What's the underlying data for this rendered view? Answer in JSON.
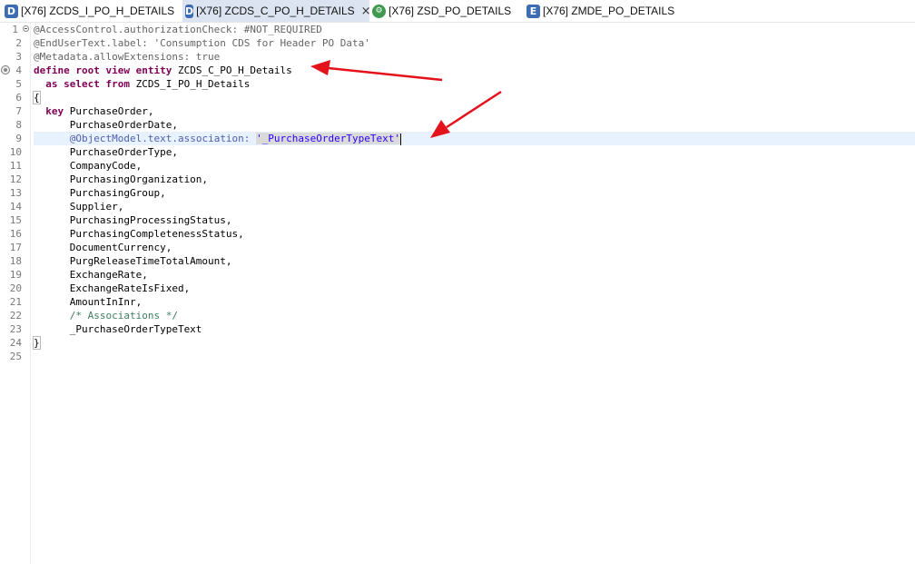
{
  "tabs": [
    {
      "icon": "D",
      "label": "[X76] ZCDS_I_PO_H_DETAILS",
      "active": false
    },
    {
      "icon": "D",
      "label": "[X76] ZCDS_C_PO_H_DETAILS",
      "active": true,
      "close": "×"
    },
    {
      "icon": "⚙",
      "label": "[X76] ZSD_PO_DETAILS",
      "active": false
    },
    {
      "icon": "E",
      "label": "[X76] ZMDE_PO_DETAILS",
      "active": false
    }
  ],
  "line_numbers": [
    "1",
    "2",
    "3",
    "4",
    "5",
    "6",
    "7",
    "8",
    "9",
    "10",
    "11",
    "12",
    "13",
    "14",
    "15",
    "16",
    "17",
    "18",
    "19",
    "20",
    "21",
    "22",
    "23",
    "24",
    "25"
  ],
  "code": {
    "l1": "@AccessControl.authorizationCheck: #NOT_REQUIRED",
    "l2": "@EndUserText.label: 'Consumption CDS for Header PO Data'",
    "l3": "@Metadata.allowExtensions: true",
    "l4_kw": "define root view entity",
    "l4_name": " ZCDS_C_PO_H_Details",
    "l5_kw": "  as select from",
    "l5_name": " ZCDS_I_PO_H_Details",
    "l6": "{",
    "l7_kw": "  key",
    "l7_name": " PurchaseOrder,",
    "l8": "      PurchaseOrderDate,",
    "l9_indent": "      ",
    "l9_ann": "@ObjectModel.text.association:",
    "l9_sp": " ",
    "l9_str": "'_PurchaseOrderTypeText'",
    "l10": "      PurchaseOrderType,",
    "l11": "      CompanyCode,",
    "l12": "      PurchasingOrganization,",
    "l13": "      PurchasingGroup,",
    "l14": "      Supplier,",
    "l15": "      PurchasingProcessingStatus,",
    "l16": "      PurchasingCompletenessStatus,",
    "l17": "      DocumentCurrency,",
    "l18": "      PurgReleaseTimeTotalAmount,",
    "l19": "      ExchangeRate,",
    "l20": "      ExchangeRateIsFixed,",
    "l21": "      AmountInInr,",
    "l22_indent": "      ",
    "l22_cmt": "/* Associations */",
    "l23": "      _PurchaseOrderTypeText",
    "l24": "}",
    "l25": ""
  },
  "colors": {
    "keyword": "#7f0055",
    "annotation": "#646464",
    "string": "#2a00ff",
    "comment": "#3f7f5f",
    "arrow": "#e3121b",
    "active_tab": "#dbe4f0",
    "current_line": "#e8f2fe"
  },
  "icons": [
    "cds-document-icon",
    "service-definition-icon",
    "metadata-extension-icon",
    "close-icon",
    "arrow-annotation-icon"
  ]
}
